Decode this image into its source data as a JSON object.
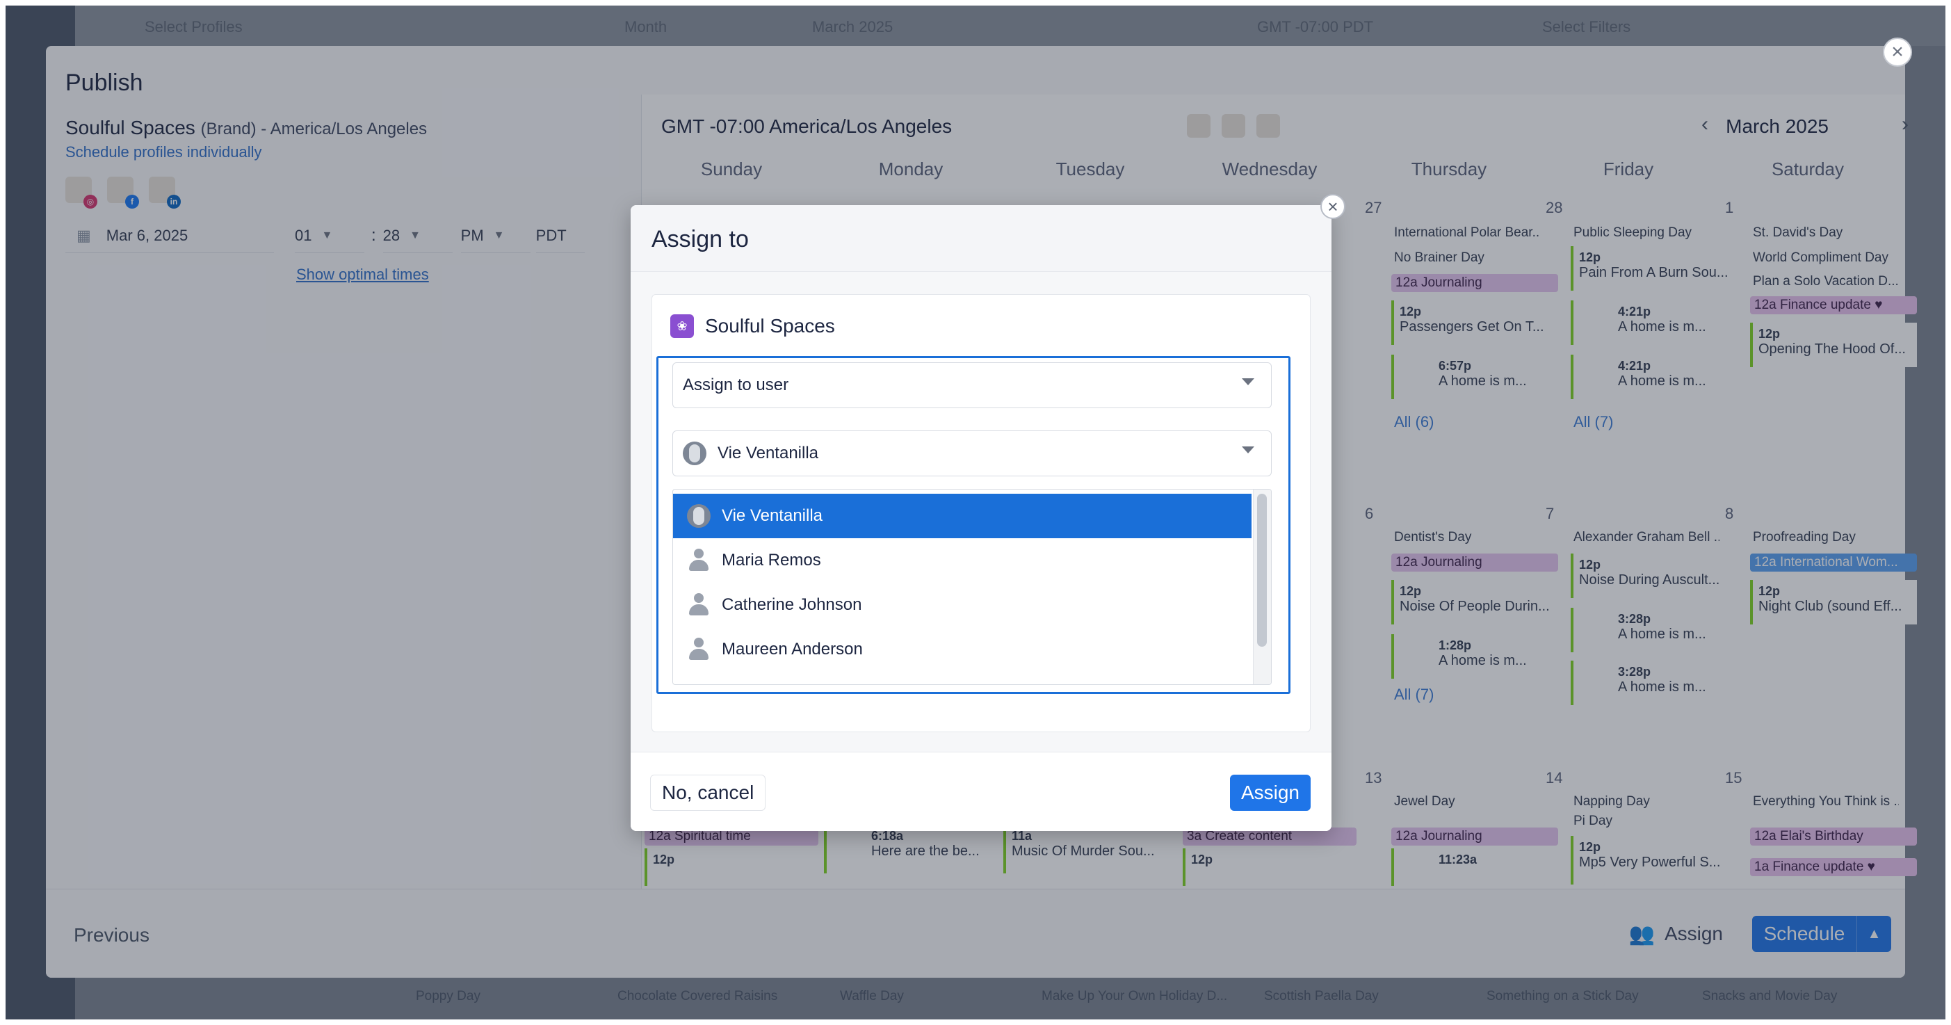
{
  "background_app": {
    "top_labels": [
      "Select Profiles",
      "Month",
      "March 2025",
      "GMT -07:00 PDT",
      "Select Filters"
    ]
  },
  "publish": {
    "title": "Publish",
    "close_icon": "close-icon",
    "brand_title": "Soulful Spaces",
    "brand_suffix": "(Brand) - America/Los Angeles",
    "schedule_individually_link": "Schedule profiles individually",
    "profile_icons": [
      "instagram-icon",
      "facebook-icon",
      "linkedin-icon"
    ],
    "date": "Mar 6, 2025",
    "hour": "01",
    "minute": "28",
    "ampm": "PM",
    "tz": "PDT",
    "optimal_link": "Show optimal times",
    "calendar": {
      "timezone": "GMT -07:00 America/Los Angeles",
      "month": "March 2025",
      "days": [
        "Sunday",
        "Monday",
        "Tuesday",
        "Wednesday",
        "Thursday",
        "Friday",
        "Saturday"
      ],
      "week1": {
        "thu": {
          "num": "27",
          "events": [
            "International Polar Bear...",
            "No Brainer Day"
          ],
          "pill": "12a  Journaling",
          "cards": [
            {
              "t": "12p",
              "text": "Passengers Get On T..."
            },
            {
              "t": "6:57p",
              "text": "A home is m..."
            }
          ],
          "all": "All (6)"
        },
        "fri": {
          "num": "28",
          "events": [
            "Public Sleeping Day"
          ],
          "cards": [
            {
              "t": "12p",
              "text": "Pain From A Burn Sou..."
            },
            {
              "t": "4:21p",
              "text": "A home is m..."
            },
            {
              "t": "4:21p",
              "text": "A home is m..."
            }
          ],
          "all": "All (7)"
        },
        "sat": {
          "num": "1",
          "events": [
            "St. David's Day",
            "World Compliment Day",
            "Plan a Solo Vacation D..."
          ],
          "pill": "12a  Finance update ♥",
          "cards": [
            {
              "t": "12p",
              "text": "Opening The Hood Of..."
            }
          ]
        }
      },
      "week2": {
        "thu": {
          "num": "6",
          "events": [
            "Dentist's Day"
          ],
          "pill": "12a  Journaling",
          "cards": [
            {
              "t": "12p",
              "text": "Noise Of People Durin..."
            },
            {
              "t": "1:28p",
              "text": "A home is m..."
            }
          ],
          "all": "All (7)"
        },
        "fri": {
          "num": "7",
          "events": [
            "Alexander Graham Bell ..."
          ],
          "cards": [
            {
              "t": "12p",
              "text": "Noise During Auscult..."
            },
            {
              "t": "3:28p",
              "text": "A home is m..."
            },
            {
              "t": "3:28p",
              "text": "A home is m..."
            }
          ]
        },
        "sat": {
          "num": "8",
          "events": [
            "Proofreading Day"
          ],
          "pill": "12a  International Wom...",
          "cards": [
            {
              "t": "12p",
              "text": "Night Club (sound Eff..."
            }
          ]
        }
      },
      "week3": {
        "sun": {
          "pill": "12a  Spiritual time",
          "card": {
            "t": "12p",
            "text": ""
          }
        },
        "mon": {
          "card": {
            "t": "6:18a",
            "text": "Here are the be..."
          }
        },
        "tue": {
          "card": {
            "t": "11a",
            "text": "Music Of Murder Sou..."
          }
        },
        "wed": {
          "pill": "3a  Create content",
          "card": {
            "t": "12p",
            "text": ""
          }
        },
        "thu": {
          "num": "13",
          "events": [
            "Jewel Day"
          ],
          "pill": "12a  Journaling",
          "card": {
            "t": "11:23a",
            "text": ""
          }
        },
        "fri": {
          "num": "14",
          "events": [
            "Napping Day",
            "Pi Day"
          ],
          "card": {
            "t": "12p",
            "text": "Mp5 Very Powerful S..."
          }
        },
        "sat": {
          "num": "15",
          "events": [
            "Everything You Think is ..."
          ],
          "pill": "12a  Elai's Birthday",
          "pill2": "1a  Finance update ♥"
        }
      }
    },
    "footer": {
      "previous": "Previous",
      "assign": "Assign",
      "schedule": "Schedule"
    }
  },
  "below_events": [
    "Poppy Day",
    "Chocolate Covered Raisins",
    "Waffle Day",
    "Make Up Your Own Holiday D...",
    "Scottish Paella Day",
    "Something on a Stick Day",
    "Snacks and Movie Day"
  ],
  "modal": {
    "title": "Assign to",
    "close_icon": "close-icon",
    "brand_name": "Soulful Spaces",
    "assign_select": "Assign to user",
    "user_select": "Vie Ventanilla",
    "options": [
      "Vie Ventanilla",
      "Maria Remos",
      "Catherine Johnson",
      "Maureen Anderson"
    ],
    "selected_option": "Vie Ventanilla",
    "cancel": "No, cancel",
    "assign": "Assign"
  },
  "colors": {
    "accent": "#1f75e8",
    "journaling_pill": "#e6c6ef",
    "finance_pill": "#e9c2ee",
    "int_women_pill": "#5aa0f0",
    "card_border": "#7ed321"
  }
}
